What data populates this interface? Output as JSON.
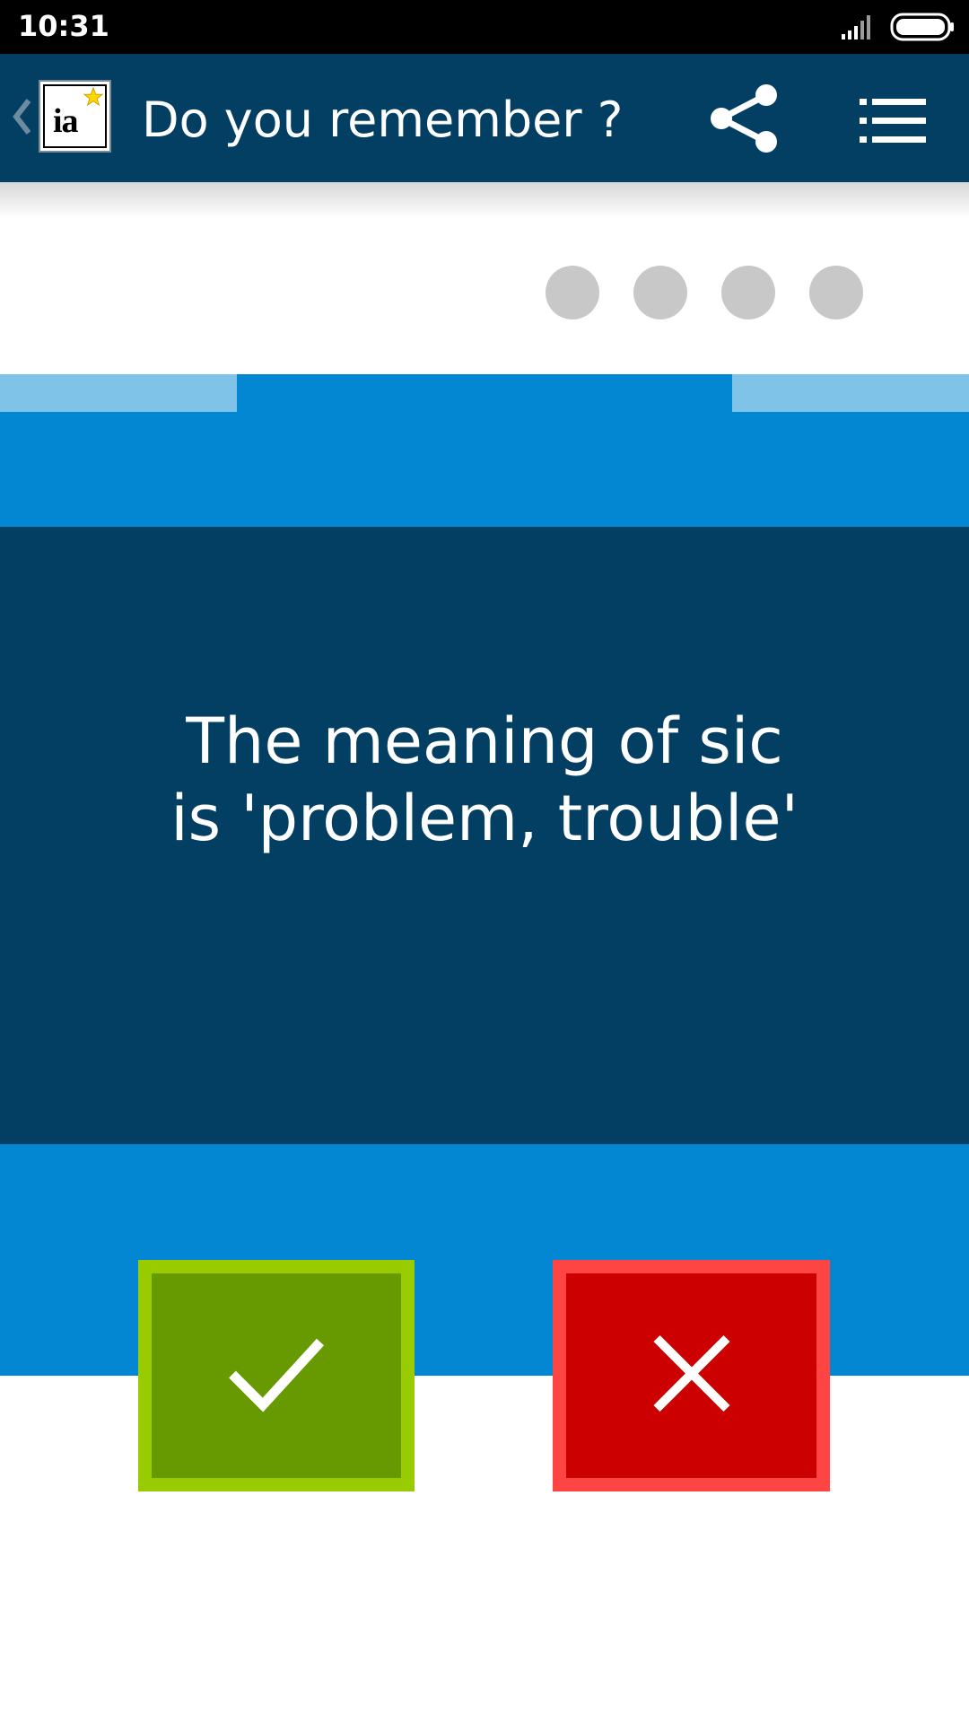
{
  "status_bar": {
    "time": "10:31",
    "icons": [
      "signal-icon",
      "battery-icon"
    ]
  },
  "app_bar": {
    "back_icon": "chevron-left-icon",
    "logo_text": "ia",
    "title": "Do you remember ?",
    "share_icon": "share-icon",
    "menu_icon": "list-menu-icon"
  },
  "progress_dots": 4,
  "card": {
    "text": "The meaning of sic\nis 'problem, trouble'"
  },
  "answers": {
    "yes_icon": "check-icon",
    "no_icon": "close-icon"
  },
  "colors": {
    "app_bar": "#033f63",
    "card": "#033f63",
    "accent_blue": "#0387d2",
    "light_blue": "#80c3e8",
    "yes_fill": "#669a00",
    "yes_border": "#99cc00",
    "no_fill": "#cc0000",
    "no_border": "#ff4444",
    "dot": "#c8c8c8"
  }
}
